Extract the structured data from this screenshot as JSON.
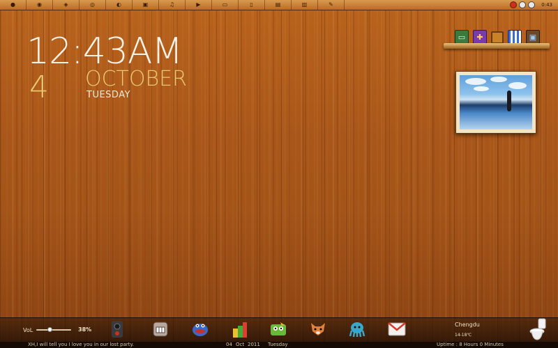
{
  "top_bar": {
    "icons": [
      "apple-icon",
      "ghost-icon",
      "feed-icon",
      "chrome-icon",
      "settings-icon",
      "folder-icon",
      "music-icon",
      "player-icon",
      "display-icon",
      "phone-icon",
      "book-icon",
      "notebook-icon",
      "paint-icon"
    ],
    "time": "0:43"
  },
  "clock": {
    "time": "12:43AM",
    "day": "4",
    "month": "OCTOBER",
    "weekday": "TUESDAY"
  },
  "shelf": {
    "icons": [
      "computer-icon",
      "gift-icon",
      "frame-icon",
      "store-icon",
      "tv-icon"
    ]
  },
  "volume": {
    "label": "VoL",
    "value": "38%",
    "level": 0.38
  },
  "dock": {
    "icons": [
      "speaker-icon",
      "teeth-icon",
      "blue-monster-icon",
      "stack-monster-icon",
      "green-monster-icon",
      "fox-icon",
      "octopus-icon",
      "mail-icon"
    ]
  },
  "weather": {
    "city": "Chengdu",
    "temp": "14-18℃"
  },
  "status": {
    "message": "XH,I will tell you I love you in our lost party.",
    "date_day": "04",
    "date_month": "Oct",
    "date_year": "2011",
    "date_weekday": "Tuesday",
    "uptime": "Uptime : 8 Hours 0 Minutes"
  },
  "colors": {
    "wood": "#a9561a",
    "clock_text": "#f7f1e6",
    "accent_gold": "#e8c870"
  }
}
